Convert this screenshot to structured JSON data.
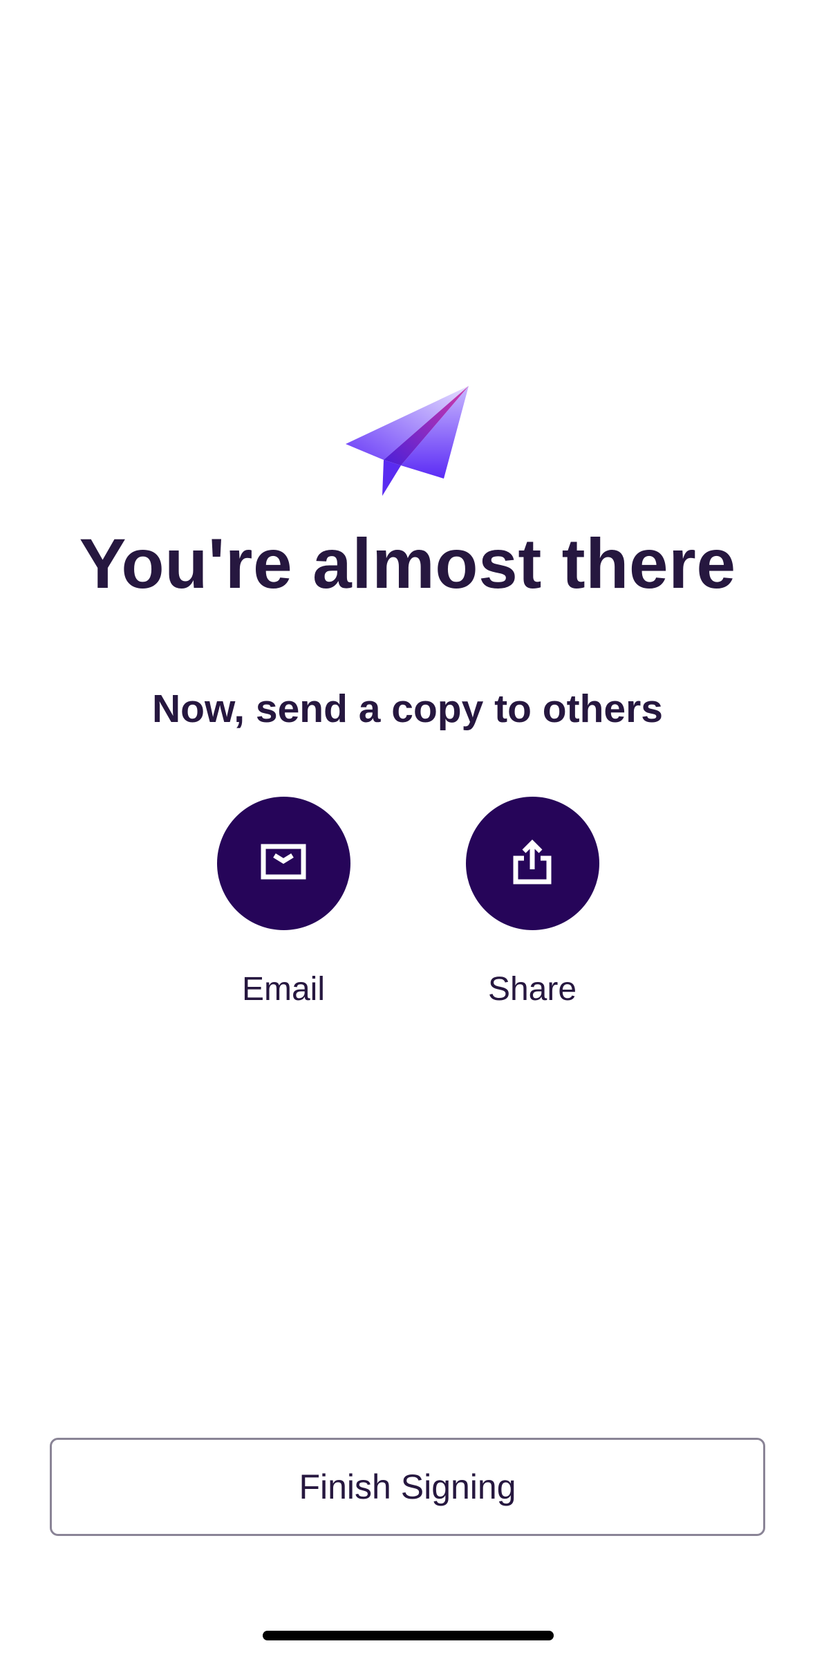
{
  "screen": {
    "title": "You're almost there",
    "subtitle": "Now, send a copy to others",
    "hero_icon": "paper-plane-icon"
  },
  "actions": [
    {
      "label": "Email",
      "icon": "envelope-icon"
    },
    {
      "label": "Share",
      "icon": "share-icon"
    }
  ],
  "footer": {
    "finish_label": "Finish Signing"
  },
  "colors": {
    "text": "#26173f",
    "action_circle": "#260559",
    "button_border": "#8a8496",
    "plane_gradient_light": "#e4dcff",
    "plane_gradient_dark": "#5b2bf5",
    "plane_accent": "#c23bb8"
  }
}
